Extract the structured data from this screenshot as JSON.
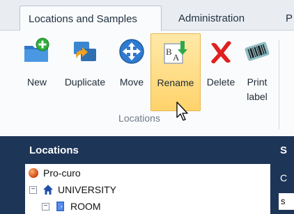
{
  "tabs": [
    {
      "label": "Locations and Samples",
      "active": true
    },
    {
      "label": "Administration",
      "active": false
    },
    {
      "label": "P",
      "active": false
    }
  ],
  "ribbon": {
    "buttons": {
      "new": "New",
      "duplicate": "Duplicate",
      "move": "Move",
      "rename": "Rename",
      "delete": "Delete",
      "print_label": "Print\nlabel"
    },
    "group_label": "Locations",
    "hovered": "rename"
  },
  "panel": {
    "title": "Locations",
    "right_title": "S",
    "right_subtitle": "C",
    "right_box": "s"
  },
  "tree": [
    {
      "label": "Pro-curo",
      "icon": "globe-icon",
      "expander": ""
    },
    {
      "label": "UNIVERSITY",
      "icon": "house-icon",
      "expander": "−"
    },
    {
      "label": "ROOM",
      "icon": "room-icon",
      "expander": "−"
    }
  ],
  "colors": {
    "panel_bg": "#1d3557",
    "hover_highlight": "#ffd36b",
    "tab_bar": "#e9edf2"
  }
}
